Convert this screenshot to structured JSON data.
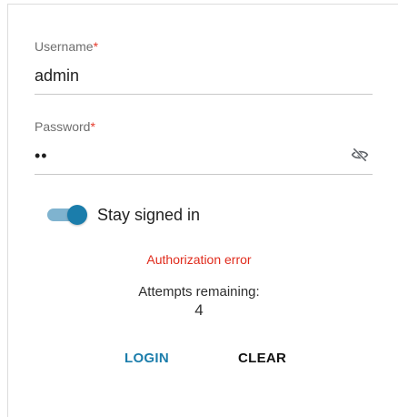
{
  "form": {
    "username": {
      "label": "Username",
      "required_mark": "*",
      "value": "admin"
    },
    "password": {
      "label": "Password",
      "required_mark": "*",
      "value": "••",
      "visibility_icon": "eye-off-icon"
    },
    "stay_signed_in": {
      "label": "Stay signed in",
      "checked": true
    },
    "error": "Authorization error",
    "attempts": {
      "label": "Attempts remaining:",
      "count": "4"
    },
    "buttons": {
      "login": "LOGIN",
      "clear": "CLEAR"
    }
  },
  "colors": {
    "accent": "#1b7dab",
    "error": "#e02b1c",
    "required": "#e53a2b"
  }
}
